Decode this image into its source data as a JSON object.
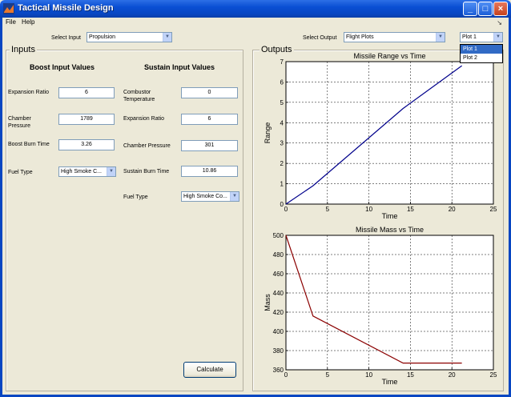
{
  "window": {
    "title": "Tactical Missile Design"
  },
  "menu": {
    "file": "File",
    "help": "Help",
    "dock_arrow": "↘"
  },
  "top": {
    "select_input_label": "Select Input",
    "select_input_value": "Propulsion",
    "select_output_label": "Select Output",
    "select_output_value": "Flight Plots",
    "plot_select_value": "Plot 1",
    "plot_options": [
      "Plot 1",
      "Plot 2"
    ]
  },
  "inputs": {
    "title": "Inputs",
    "boost": {
      "heading": "Boost Input Values",
      "expansion_ratio_label": "Expansion Ratio",
      "expansion_ratio": "6",
      "chamber_pressure_label": "Chamber Pressure",
      "chamber_pressure": "1789",
      "burn_time_label": "Boost Burn Time",
      "burn_time": "3.26",
      "fuel_type_label": "Fuel Type",
      "fuel_type": "High Smoke C..."
    },
    "sustain": {
      "heading": "Sustain Input Values",
      "combustor_temp_label": "Combustor Temperature",
      "combustor_temp": "0",
      "expansion_ratio_label": "Expansion Ratio",
      "expansion_ratio": "6",
      "chamber_pressure_label": "Chamber Pressure",
      "chamber_pressure": "301",
      "burn_time_label": "Sustain Burn Time",
      "burn_time": "10.86",
      "fuel_type_label": "Fuel Type",
      "fuel_type": "High Smoke Co..."
    },
    "calculate_label": "Calculate"
  },
  "outputs": {
    "title": "Outputs"
  },
  "colors": {
    "range_line": "#00008b",
    "mass_line": "#8b0000",
    "title_bar": "#0846c2"
  },
  "chart_data": [
    {
      "type": "line",
      "title": "Missile Range vs Time",
      "xlabel": "Time",
      "ylabel": "Range",
      "xlim": [
        0,
        25
      ],
      "ylim": [
        0,
        7
      ],
      "xticks": [
        0,
        5,
        10,
        15,
        20,
        25
      ],
      "yticks": [
        0,
        1,
        2,
        3,
        4,
        5,
        6,
        7
      ],
      "grid": true,
      "series": [
        {
          "x": [
            0,
            3.26,
            14.12,
            21.2
          ],
          "y": [
            0,
            0.9,
            4.7,
            6.8
          ]
        }
      ]
    },
    {
      "type": "line",
      "title": "Missile Mass vs Time",
      "xlabel": "Time",
      "ylabel": "Mass",
      "xlim": [
        0,
        25
      ],
      "ylim": [
        360,
        500
      ],
      "xticks": [
        0,
        5,
        10,
        15,
        20,
        25
      ],
      "yticks": [
        360,
        380,
        400,
        420,
        440,
        460,
        480,
        500
      ],
      "grid": true,
      "series": [
        {
          "x": [
            0,
            3.26,
            14.12,
            21.2
          ],
          "y": [
            500,
            416,
            367,
            367
          ]
        }
      ]
    }
  ]
}
